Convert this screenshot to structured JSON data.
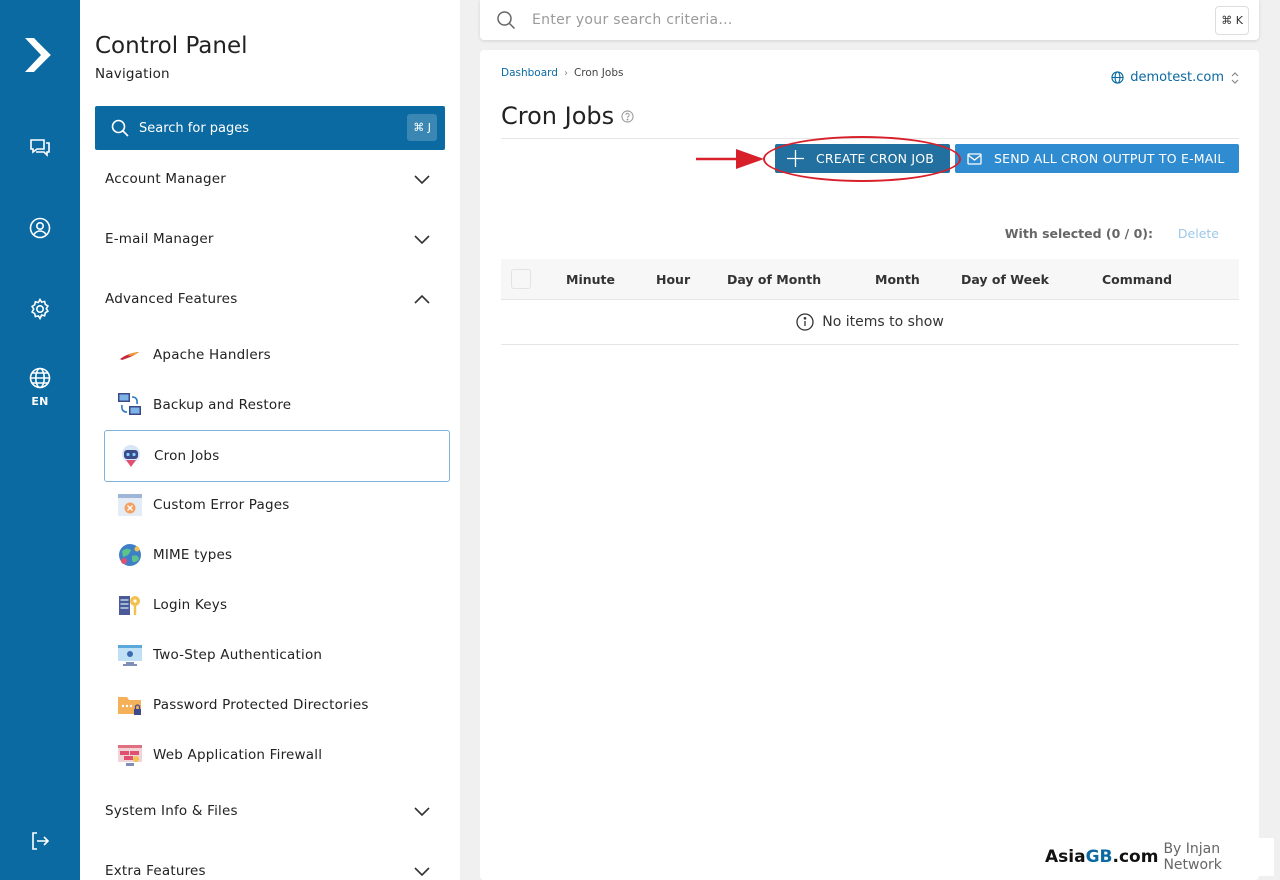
{
  "rail": {
    "language": "EN"
  },
  "nav": {
    "title": "Control Panel",
    "subtitle": "Navigation",
    "search_label": "Search for pages",
    "search_shortcut": "⌘ J",
    "sections": {
      "account": "Account Manager",
      "email": "E-mail Manager",
      "advanced": "Advanced Features",
      "sysinfo": "System Info & Files",
      "extra": "Extra Features"
    },
    "items": [
      "Apache Handlers",
      "Backup and Restore",
      "Cron Jobs",
      "Custom Error Pages",
      "MIME types",
      "Login Keys",
      "Two-Step Authentication",
      "Password Protected Directories",
      "Web Application Firewall"
    ],
    "active_item": "Cron Jobs"
  },
  "topsearch": {
    "placeholder": "Enter your search criteria...",
    "shortcut": "⌘ K"
  },
  "breadcrumb": [
    "Dashboard",
    "Cron Jobs"
  ],
  "domain": "demotest.com",
  "page_title": "Cron Jobs",
  "buttons": {
    "create": "CREATE CRON JOB",
    "send": "SEND ALL CRON OUTPUT TO E-MAIL"
  },
  "table": {
    "with_selected": "With selected (0 / 0):",
    "delete": "Delete",
    "columns": [
      "Minute",
      "Hour",
      "Day of Month",
      "Month",
      "Day of Week",
      "Command"
    ],
    "empty": "No items to show"
  },
  "watermark": {
    "a": "Asia",
    "b": "GB",
    "c": ".com",
    "d": "By Injan Network"
  },
  "colors": {
    "brand": "#0b6aa2",
    "annotation": "#d8202b",
    "send_button": "#2f8cd0"
  }
}
